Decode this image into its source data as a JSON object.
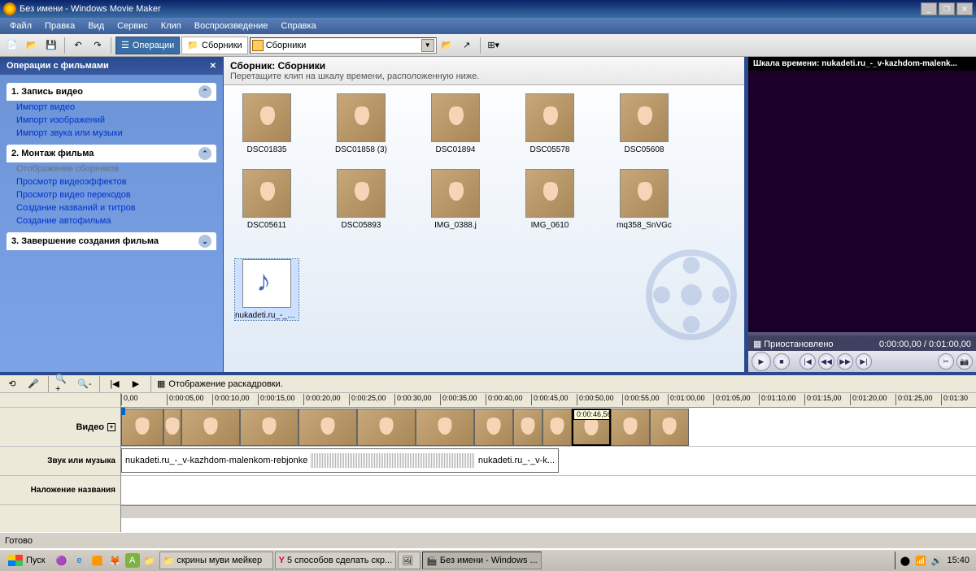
{
  "window": {
    "title": "Без имени - Windows Movie Maker"
  },
  "menu": [
    "Файл",
    "Правка",
    "Вид",
    "Сервис",
    "Клип",
    "Воспроизведение",
    "Справка"
  ],
  "toolbar": {
    "tasks": "Операции",
    "collections": "Сборники",
    "combo": "Сборники"
  },
  "taskpane": {
    "title": "Операции с фильмами",
    "s1": {
      "title": "1. Запись видео",
      "links": [
        "Импорт видео",
        "Импорт изображений",
        "Импорт звука или музыки"
      ]
    },
    "s2": {
      "title": "2. Монтаж фильма",
      "grey": "Отображение сборников",
      "links": [
        "Просмотр видеоэффектов",
        "Просмотр видео переходов",
        "Создание названий и титров",
        "Создание автофильма"
      ]
    },
    "s3": {
      "title": "3. Завершение создания фильма"
    }
  },
  "collection": {
    "title": "Сборник: Сборники",
    "sub": "Перетащите клип на шкалу времени, расположенную ниже.",
    "thumbs": [
      "DSC01835",
      "DSC01858 (3)",
      "DSC01894",
      "DSC05578",
      "DSC05608",
      "DSC05611",
      "DSC05893",
      "IMG_0388.j",
      "IMG_0610",
      "mq358_SnVGc"
    ],
    "audio": "nukadeti.ru_-_v-kazhdom..."
  },
  "preview": {
    "title": "Шкала времени: nukadeti.ru_-_v-kazhdom-malenk...",
    "status": "Приостановлено",
    "time": "0:00:00,00 / 0:01:00,00"
  },
  "timeline": {
    "toggle": "Отображение раскадровки.",
    "ticks": [
      "0,00",
      "0:00:05,00",
      "0:00:10,00",
      "0:00:15,00",
      "0:00:20,00",
      "0:00:25,00",
      "0:00:30,00",
      "0:00:35,00",
      "0:00:40,00",
      "0:00:45,00",
      "0:00:50,00",
      "0:00:55,00",
      "0:01:00,00",
      "0:01:05,00",
      "0:01:10,00",
      "0:01:15,00",
      "0:01:20,00",
      "0:01:25,00",
      "0:01:30"
    ],
    "tracks": {
      "video": "Видео",
      "audio": "Звук или музыка",
      "title": "Наложение названия"
    },
    "tip": "0:00:46,56",
    "audioClip": "nukadeti.ru_-_v-kazhdom-malenkom-rebjonke",
    "audioClipEnd": "nukadeti.ru_-_v-k..."
  },
  "status": "Готово",
  "taskbar": {
    "start": "Пуск",
    "tasks": [
      "скрины муви мейкер",
      "5 способов сделать скр...",
      "",
      "Без имени - Windows ..."
    ],
    "time": "15:40"
  }
}
